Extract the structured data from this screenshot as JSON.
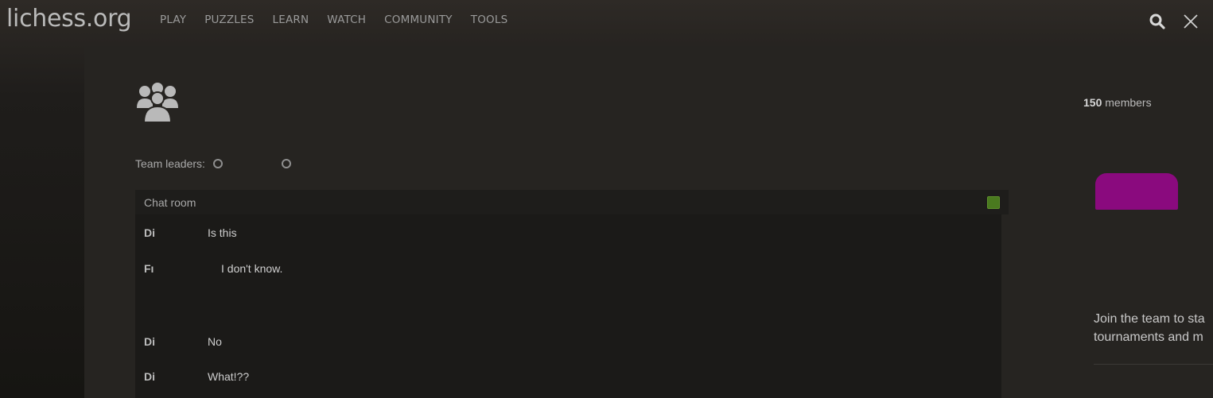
{
  "brand": {
    "name": "lichess.org"
  },
  "nav": {
    "items": [
      {
        "label": "PLAY"
      },
      {
        "label": "PUZZLES"
      },
      {
        "label": "LEARN"
      },
      {
        "label": "WATCH"
      },
      {
        "label": "COMMUNITY"
      },
      {
        "label": "TOOLS"
      }
    ]
  },
  "icons": {
    "search": "search-icon",
    "close": "close-icon",
    "team": "team-icon"
  },
  "team": {
    "leaders_label": "Team leaders:"
  },
  "chat": {
    "title": "Chat room",
    "messages": [
      {
        "user": "Di",
        "text": "Is this"
      },
      {
        "user": "Fı",
        "text": "I don't know."
      },
      {
        "user": "Di",
        "text": "No"
      },
      {
        "user": "Di",
        "text": "What!??"
      }
    ]
  },
  "sidebar": {
    "members_count": "150",
    "members_label": "members",
    "join_line1": "Join the team to sta",
    "join_line2": "tournaments and m"
  },
  "colors": {
    "accent_badge": "#8a0a7e",
    "chat_toggle": "#4a7a1f",
    "panel_bg": "#262421"
  }
}
